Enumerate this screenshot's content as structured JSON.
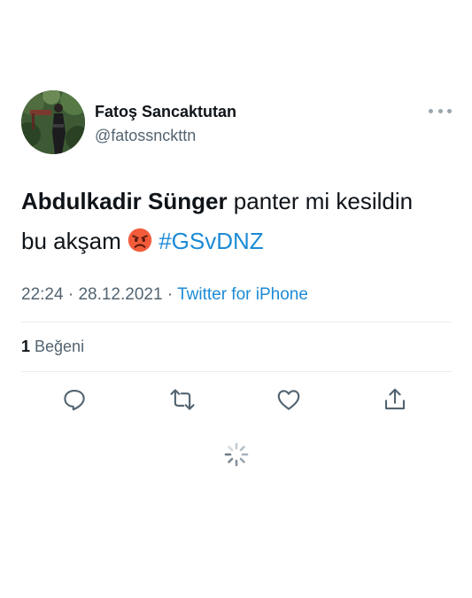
{
  "author": {
    "display_name": "Fatoş Sancaktutan",
    "handle": "@fatossnckttn"
  },
  "tweet": {
    "mention": "Abdulkadir Sünger",
    "text_part1": " panter mi kesildin bu akşam ",
    "emoji": "angry-face-emoji",
    "hashtag": "#GSvDNZ"
  },
  "meta": {
    "time": "22:24",
    "separator": " · ",
    "date": "28.12.2021",
    "source": "Twitter for iPhone"
  },
  "stats": {
    "likes_count": "1",
    "likes_label": " Beğeni"
  },
  "actions": [
    {
      "name": "reply-icon"
    },
    {
      "name": "retweet-icon"
    },
    {
      "name": "like-icon"
    },
    {
      "name": "share-icon"
    }
  ],
  "colors": {
    "text": "#0f1419",
    "secondary": "#536471",
    "link": "#1d8bd6",
    "divider": "#e6ecf0"
  }
}
